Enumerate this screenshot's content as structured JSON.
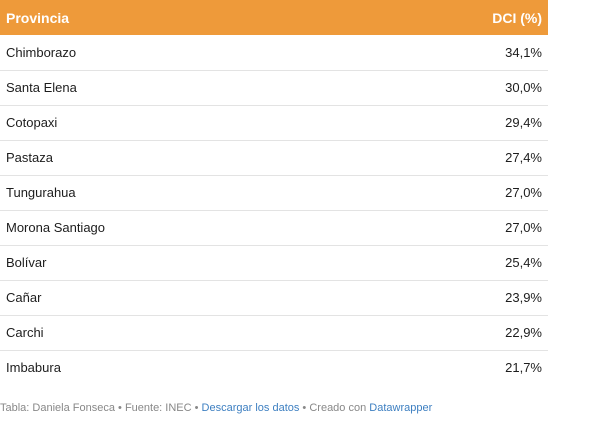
{
  "table": {
    "header": {
      "provincia": "Provincia",
      "dci": "DCI (%)"
    },
    "rows": [
      {
        "provincia": "Chimborazo",
        "dci": "34,1%"
      },
      {
        "provincia": "Santa Elena",
        "dci": "30,0%"
      },
      {
        "provincia": "Cotopaxi",
        "dci": "29,4%"
      },
      {
        "provincia": "Pastaza",
        "dci": "27,4%"
      },
      {
        "provincia": "Tungurahua",
        "dci": "27,0%"
      },
      {
        "provincia": "Morona Santiago",
        "dci": "27,0%"
      },
      {
        "provincia": "Bolívar",
        "dci": "25,4%"
      },
      {
        "provincia": "Cañar",
        "dci": "23,9%"
      },
      {
        "provincia": "Carchi",
        "dci": "22,9%"
      },
      {
        "provincia": "Imbabura",
        "dci": "21,7%"
      }
    ]
  },
  "footer": {
    "credit": "Tabla: Daniela Fonseca",
    "source": "Fuente: INEC",
    "download_link": "Descargar los datos",
    "created": "Creado con",
    "tool_link": "Datawrapper",
    "separator": " • "
  },
  "colors": {
    "header_bg": "#ee9a3a",
    "link": "#3d7fc1"
  }
}
